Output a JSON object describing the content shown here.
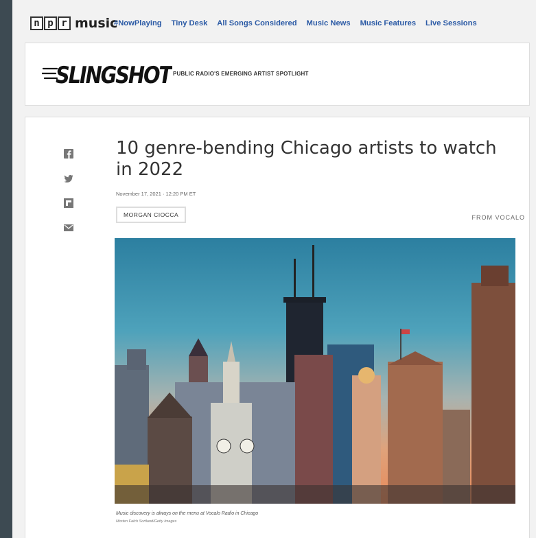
{
  "header": {
    "logo_letters": [
      "n",
      "p",
      "r"
    ],
    "logo_music": "music",
    "nav_links": [
      {
        "label": "#NowPlaying"
      },
      {
        "label": "Tiny Desk"
      },
      {
        "label": "All Songs Considered"
      },
      {
        "label": "Music News"
      },
      {
        "label": "Music Features"
      },
      {
        "label": "Live Sessions"
      }
    ]
  },
  "banner": {
    "logo_text": "SLINGSHOT",
    "tagline": "PUBLIC RADIO'S EMERGING ARTIST SPOTLIGHT"
  },
  "article": {
    "title": "10 genre-bending Chicago artists to watch in 2022",
    "date": "November 17, 2021 · 12:20 PM ET",
    "author": "MORGAN CIOCCA",
    "from": "FROM  VOCALO",
    "share_icons": [
      "facebook-icon",
      "twitter-icon",
      "flipboard-icon",
      "email-icon"
    ],
    "image": {
      "caption": "Music discovery is always on the menu at Vocalo Radio in Chicago",
      "credit": "Morten Falch Sortland/Getty Images"
    }
  },
  "colors": {
    "nav_link": "#2b5aa5",
    "page_bg": "#f2f2f2",
    "frame_bg": "#3d4a52"
  }
}
